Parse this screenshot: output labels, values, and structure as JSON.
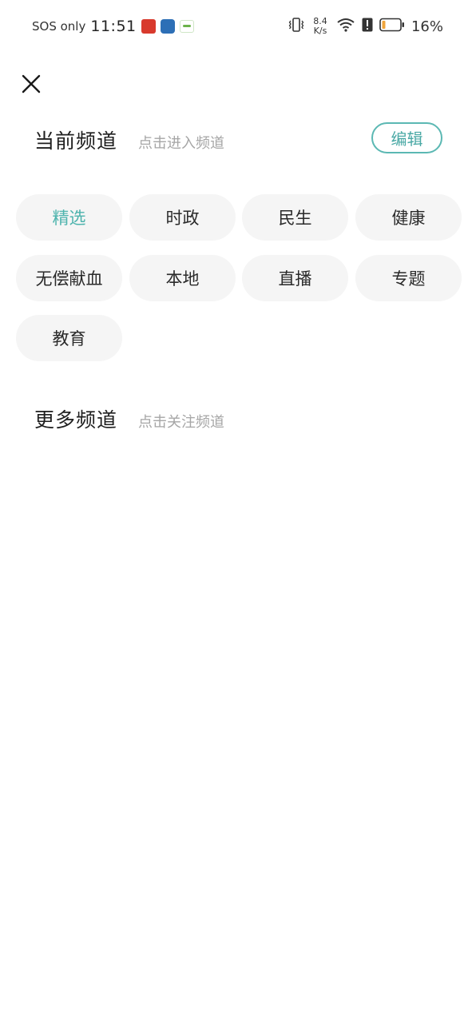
{
  "status_bar": {
    "carrier": "SOS only",
    "time": "11:51",
    "net_speed_value": "8.4",
    "net_speed_unit": "K/s",
    "battery": "16%"
  },
  "current_section": {
    "title": "当前频道",
    "hint": "点击进入频道",
    "edit_label": "编辑"
  },
  "current_channels": [
    {
      "label": "精选",
      "active": true
    },
    {
      "label": "时政",
      "active": false
    },
    {
      "label": "民生",
      "active": false
    },
    {
      "label": "健康",
      "active": false
    },
    {
      "label": "无偿献血",
      "active": false
    },
    {
      "label": "本地",
      "active": false
    },
    {
      "label": "直播",
      "active": false
    },
    {
      "label": "专题",
      "active": false
    },
    {
      "label": "教育",
      "active": false
    }
  ],
  "more_section": {
    "title": "更多频道",
    "hint": "点击关注频道"
  },
  "colors": {
    "accent": "#4db3ad",
    "chip_bg": "#f5f5f5",
    "hint": "#a6a6a6"
  }
}
